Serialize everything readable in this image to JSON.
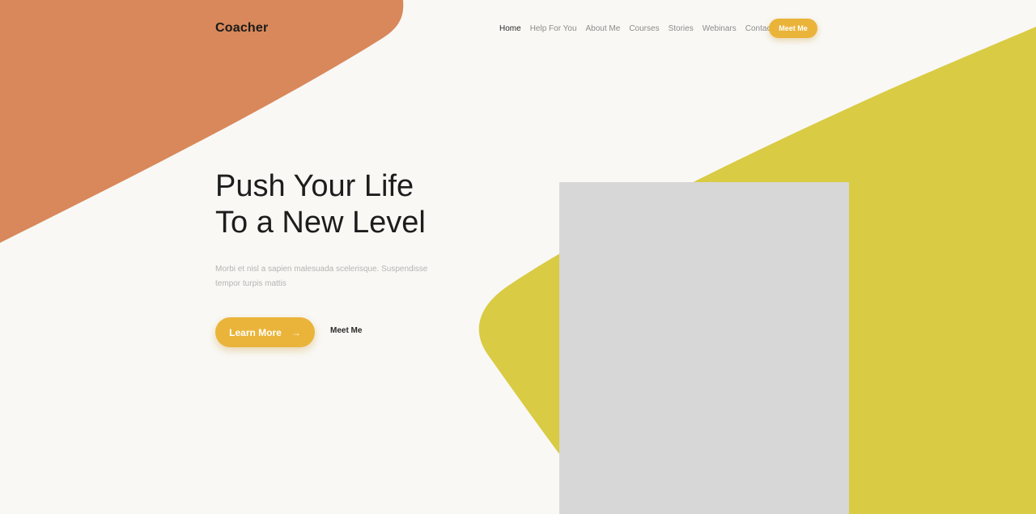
{
  "brand": {
    "logo_text": "Coacher"
  },
  "nav": {
    "items": [
      {
        "label": "Home",
        "active": true
      },
      {
        "label": "Help For You",
        "active": false
      },
      {
        "label": "About Me",
        "active": false
      },
      {
        "label": "Courses",
        "active": false
      },
      {
        "label": "Stories",
        "active": false
      },
      {
        "label": "Webinars",
        "active": false
      },
      {
        "label": "Contact",
        "active": false
      }
    ],
    "cta_label": "Meet Me"
  },
  "hero": {
    "title_line1": "Push Your Life",
    "title_line2": "To a New Level",
    "description": "Morbi et nisl a sapien malesuada scelerisque. Suspendisse tempor turpis mattis",
    "primary_button": "Learn More",
    "primary_button_icon": "arrow-right-icon",
    "secondary_button": "Meet Me",
    "image": "placeholder-image"
  },
  "colors": {
    "background": "#f9f8f5",
    "orange_shape": "#d8885a",
    "yellow_shape": "#d9cb43",
    "accent": "#eab43a",
    "image_placeholder": "#d7d7d7",
    "text_dark": "#1d1d1d",
    "text_muted": "#b4b4b4"
  }
}
